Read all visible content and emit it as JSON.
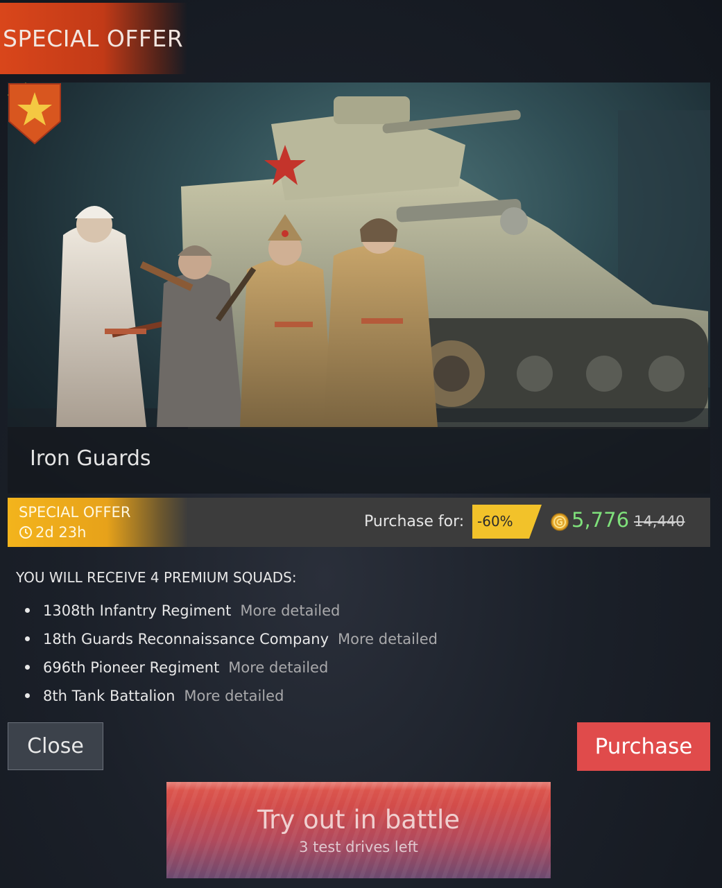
{
  "header": {
    "title": "SPECIAL OFFER"
  },
  "banner": {
    "title": "Iron Guards"
  },
  "offer": {
    "label": "SPECIAL OFFER",
    "timer": "2d 23h",
    "purchase_for": "Purchase for:",
    "discount": "-60%",
    "price": "5,776",
    "old_price": "14,440",
    "colors": {
      "discount_bg": "#f2c22a",
      "price": "#7fe17b",
      "offer_bg": "#f3b41c"
    }
  },
  "receive": {
    "title": "YOU WILL RECEIVE 4 PREMIUM SQUADS:",
    "squads": [
      {
        "name": "1308th Infantry Regiment",
        "link": "More detailed"
      },
      {
        "name": "18th Guards Reconnaissance Company",
        "link": "More detailed"
      },
      {
        "name": "696th Pioneer Regiment",
        "link": "More detailed"
      },
      {
        "name": "8th Tank Battalion",
        "link": "More detailed"
      }
    ]
  },
  "buttons": {
    "close": "Close",
    "purchase": "Purchase",
    "try": "Try out in battle",
    "try_sub": "3 test drives left"
  },
  "icons": {
    "corner": "red-star-icon",
    "rank": "rank-star-badge-icon",
    "coin": "gold-coin-icon",
    "clock": "clock-icon"
  }
}
